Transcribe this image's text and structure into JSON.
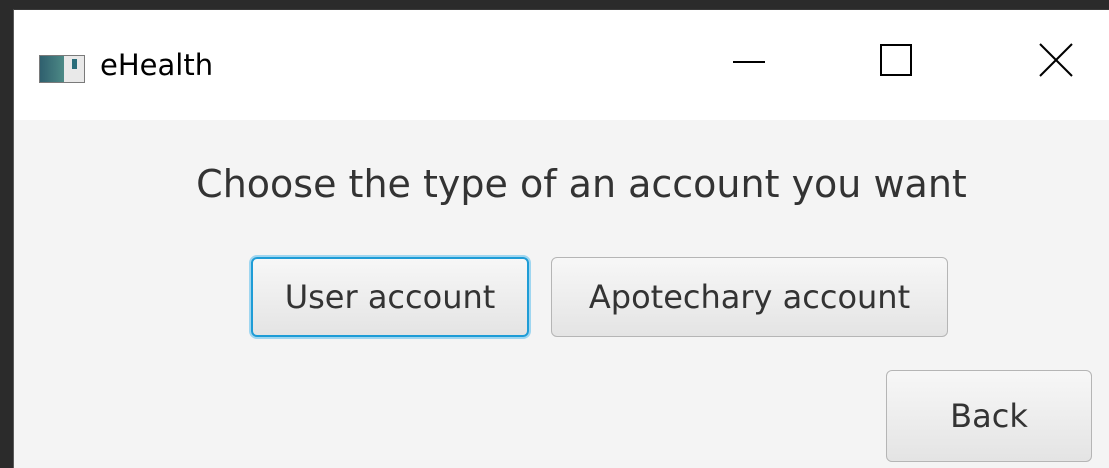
{
  "window": {
    "title": "eHealth",
    "icon": "app-icon"
  },
  "controls": {
    "minimize_icon": "minimize-icon",
    "maximize_icon": "maximize-icon",
    "close_icon": "close-icon"
  },
  "content": {
    "heading": "Choose the type of an account you want",
    "user_account_label": "User account",
    "apotechary_account_label": "Apotechary account",
    "back_label": "Back"
  },
  "colors": {
    "focus_border": "#1e9cd6",
    "window_bg": "#f4f4f4"
  }
}
